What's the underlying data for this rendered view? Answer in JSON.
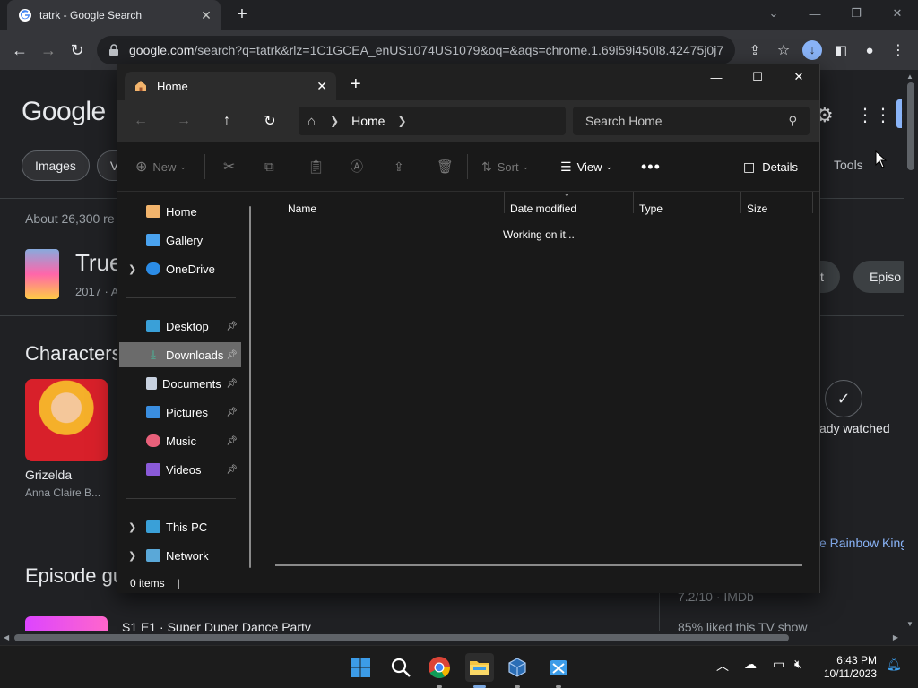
{
  "browser": {
    "tab_title": "tatrk - Google Search",
    "url_host": "google.com",
    "url_rest": "/search?q=tatrk&rlz=1C1GCEA_enUS1074US1079&oq=&aqs=chrome.1.69i59i450l8.42475j0j7..."
  },
  "google": {
    "logo": "Google",
    "chips": [
      "Images",
      "V"
    ],
    "tools": "Tools",
    "about": "About 26,300 re",
    "result_title": "True",
    "result_sub": "2017 · A",
    "pill_1": "st",
    "pill_2": "Episo",
    "characters": "Characters",
    "char_name": "Grizelda",
    "char_actor": "Anna Claire B...",
    "watched": "ady watched",
    "rainbow": "e Rainbow King",
    "episode_heading": "Episode gu",
    "rating": "7.2/10 · IMDb",
    "liked": "85% liked this TV show",
    "episode_title": "S1 E1 · Super Duper Dance Party"
  },
  "explorer": {
    "tab_title": "Home",
    "breadcrumb": "Home",
    "search_placeholder": "Search Home",
    "cmd_new": "New",
    "cmd_sort": "Sort",
    "cmd_view": "View",
    "cmd_details": "Details",
    "sidebar": {
      "home": "Home",
      "gallery": "Gallery",
      "onedrive": "OneDrive",
      "desktop": "Desktop",
      "downloads": "Downloads",
      "documents": "Documents",
      "pictures": "Pictures",
      "music": "Music",
      "videos": "Videos",
      "this_pc": "This PC",
      "network": "Network"
    },
    "columns": {
      "name": "Name",
      "date": "Date modified",
      "type": "Type",
      "size": "Size"
    },
    "loading": "Working on it...",
    "status": "0 items"
  },
  "taskbar": {
    "time": "6:43 PM",
    "date": "10/11/2023"
  }
}
